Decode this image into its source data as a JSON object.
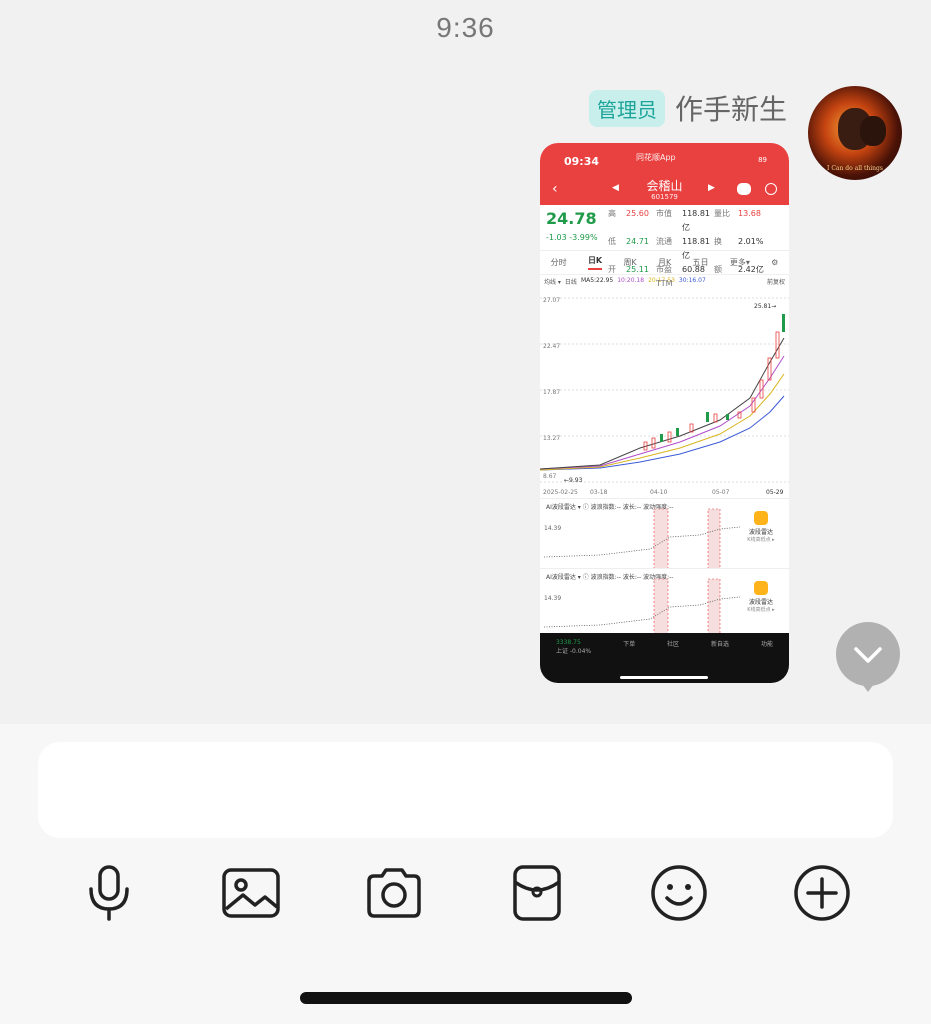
{
  "status_bar": {
    "time": "9:36"
  },
  "message": {
    "sender_badge": "管理员",
    "sender_name": "作手新生",
    "avatar_caption": "I Can do all things"
  },
  "screenshot": {
    "time": "09:34",
    "app_name": "同花顺App",
    "signal": "89",
    "stock_name": "会稽山",
    "stock_code": "601579",
    "price": "24.78",
    "change": "-1.03  -3.99%",
    "quote": {
      "high_label": "高",
      "high": "25.60",
      "low_label": "低",
      "low": "24.71",
      "open_label": "开",
      "open": "25.11",
      "mcap_label": "市值",
      "mcap": "118.81亿",
      "float_label": "流通",
      "float": "118.81亿",
      "pe_label": "市盈TTM",
      "pe": "60.88",
      "vr_label": "量比",
      "vr": "13.68",
      "turn_label": "换",
      "turn": "2.01%",
      "amt_label": "额",
      "amt": "2.42亿"
    },
    "tabs": [
      "分时",
      "日K",
      "周K",
      "月K",
      "五日",
      "更多▾",
      "⚙"
    ],
    "ma_row": [
      "均线 ▾",
      "日线",
      "MA5:22.95",
      "10:20.18",
      "20:17.53",
      "30:16.07",
      "前复权"
    ],
    "y_ticks": [
      "27.07",
      "22.47",
      "17.87",
      "13.27",
      "8.67"
    ],
    "x_ticks": [
      "2025-02-25",
      "03-18",
      "04-10",
      "05-07",
      "05-29"
    ],
    "max_label": "25.81→",
    "min_label": "←9.93",
    "panels": [
      {
        "title": "AI波段雷达 ▾   ⓘ  波浪指数:--   波长:--   波动强度:--",
        "value": "14.39",
        "radar": "波段雷达",
        "radar_sub": "K线高低点 ▸"
      },
      {
        "title": "AI波段雷达 ▾   ⓘ  波浪指数:--   波长:--   波动强度:--",
        "value": "14.39",
        "radar": "波段雷达",
        "radar_sub": "K线高低点 ▸"
      }
    ],
    "bottom_nav": {
      "index_value": "3338.75",
      "index_name": "上证  -0.04%",
      "items": [
        "下单",
        "社区",
        "新自选",
        "功能"
      ]
    }
  },
  "colors": {
    "accent_red": "#e94040",
    "accent_green": "#1f9b4a",
    "badge_bg": "#c9efec",
    "badge_text": "#1ea59a"
  },
  "toolbar_icons": [
    "microphone-icon",
    "image-icon",
    "camera-icon",
    "red-packet-icon",
    "emoji-icon",
    "plus-icon"
  ]
}
